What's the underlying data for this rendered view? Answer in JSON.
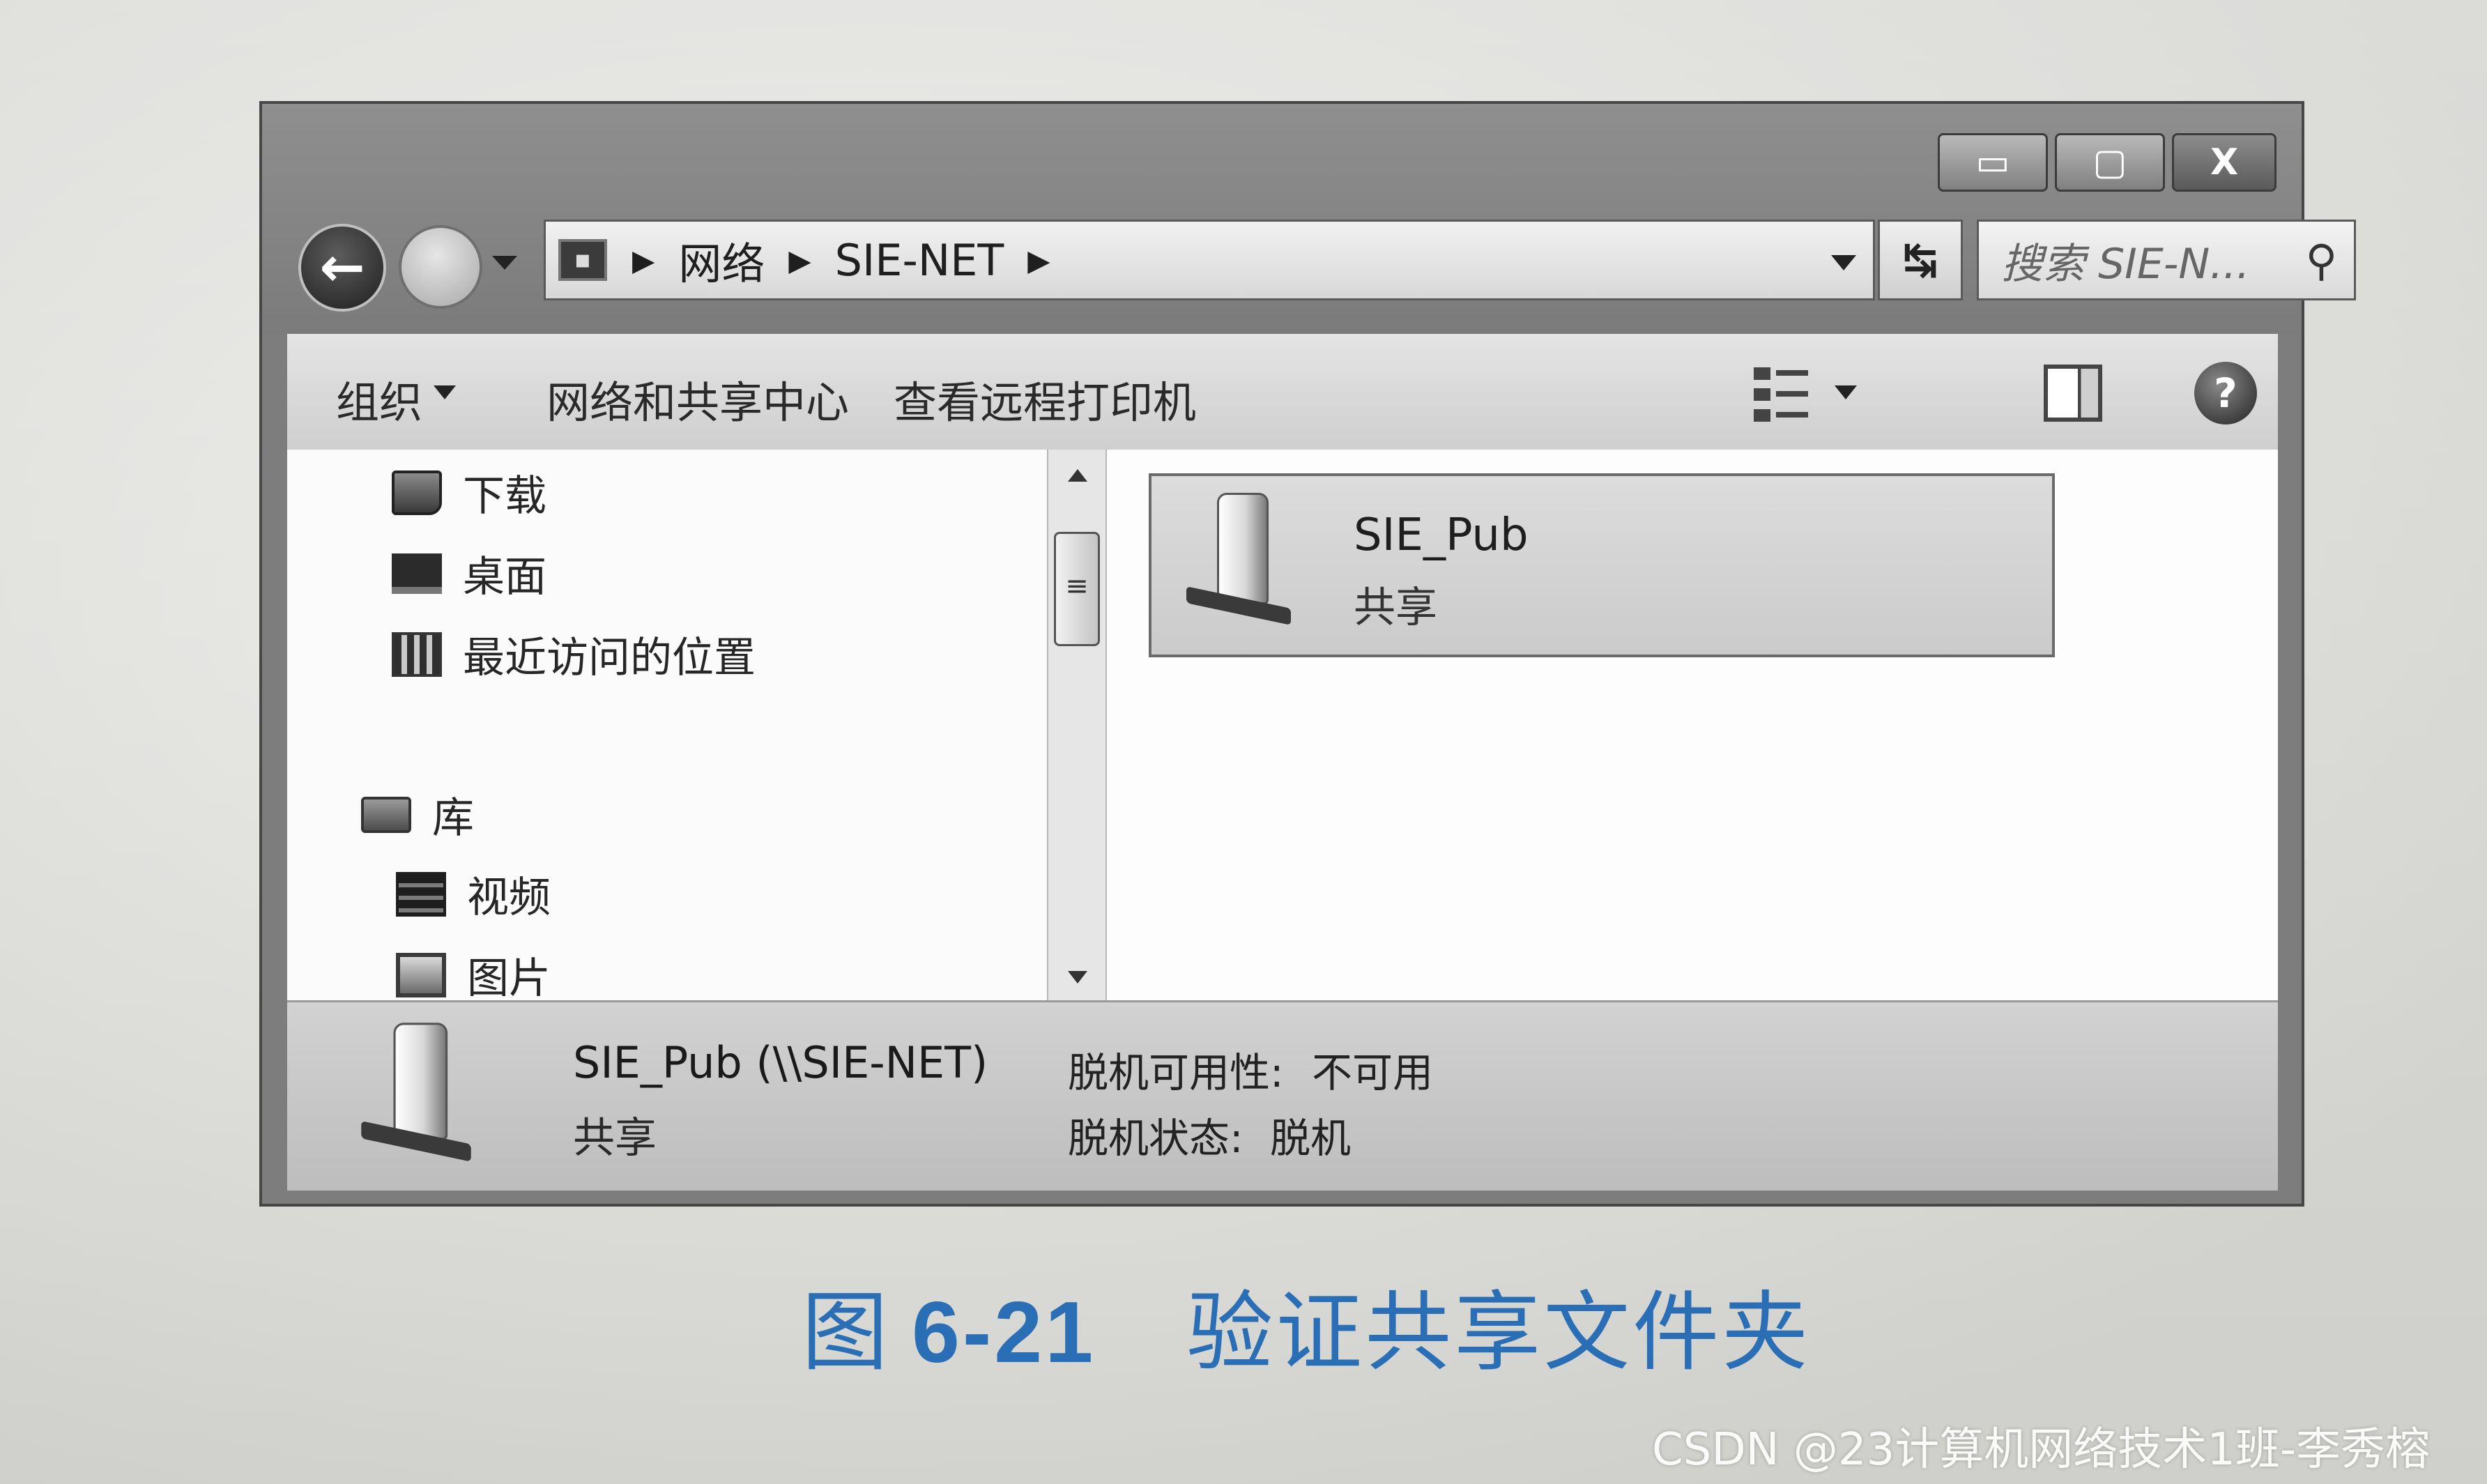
{
  "window": {
    "controls": {
      "minimize": "▭",
      "maximize": "▢",
      "close": "X"
    }
  },
  "address_bar": {
    "breadcrumbs": [
      "网络",
      "SIE-NET"
    ],
    "separator": "▶"
  },
  "search": {
    "placeholder": "搜索 SIE-N..."
  },
  "toolbar": {
    "organize": "组织",
    "network_center": "网络和共享中心",
    "remote_printers": "查看远程打印机"
  },
  "nav_tree": {
    "items": [
      "下载",
      "桌面",
      "最近访问的位置"
    ],
    "library": "库",
    "library_items": [
      "视频",
      "图片"
    ]
  },
  "content": {
    "item": {
      "name": "SIE_Pub",
      "type": "共享"
    }
  },
  "details": {
    "name": "SIE_Pub (\\\\SIE-NET)",
    "type": "共享",
    "offline_availability_label": "脱机可用性:",
    "offline_availability_value": "不可用",
    "offline_status_label": "脱机状态:",
    "offline_status_value": "脱机"
  },
  "caption": {
    "figure": "图",
    "number": "6-21",
    "text": "验证共享文件夹"
  },
  "watermark": "CSDN @23计算机网络技术1班-李秀榕"
}
